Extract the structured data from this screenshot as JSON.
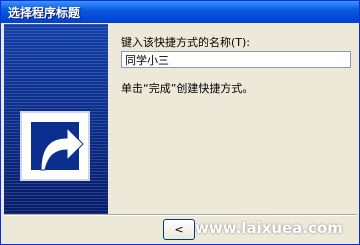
{
  "window": {
    "title": "选择程序标题",
    "accent_color": "#0a5adf",
    "panel_color": "#0b2f8f"
  },
  "illustration": {
    "icon": "shortcut-arrow-icon"
  },
  "form": {
    "prompt": "键入该快捷方式的名称(T):",
    "name_value": "同学小三",
    "hint": "单击“完成”创建快捷方式。"
  },
  "buttons": {
    "back_label": "<"
  },
  "watermark": {
    "text": "www.laixuea.com"
  }
}
